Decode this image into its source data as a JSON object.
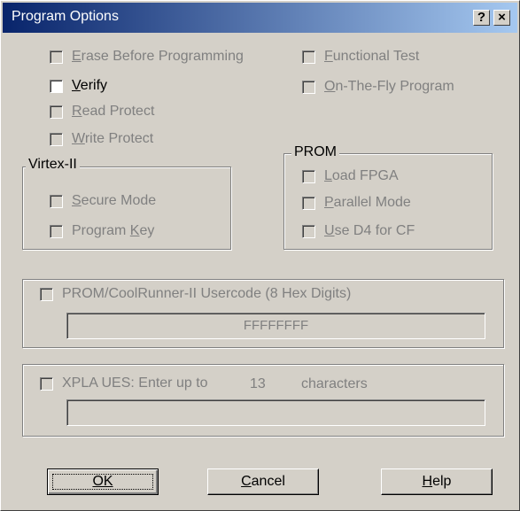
{
  "window": {
    "title": "Program Options",
    "help_glyph": "?",
    "close_glyph": "×"
  },
  "options": {
    "erase": {
      "pre": "",
      "mn": "E",
      "post": "rase Before Programming",
      "checked": false,
      "enabled": false
    },
    "verify": {
      "pre": "",
      "mn": "V",
      "post": "erify",
      "checked": false,
      "enabled": true
    },
    "read_protect": {
      "pre": "",
      "mn": "R",
      "post": "ead Protect",
      "checked": false,
      "enabled": false
    },
    "write_protect": {
      "pre": "",
      "mn": "W",
      "post": "rite Protect",
      "checked": false,
      "enabled": false
    },
    "functional_test": {
      "pre": "",
      "mn": "F",
      "post": "unctional Test",
      "checked": false,
      "enabled": false
    },
    "otf_program": {
      "pre": "",
      "mn": "O",
      "post": "n-The-Fly Program",
      "checked": false,
      "enabled": false
    }
  },
  "virtex": {
    "title": "Virtex-II",
    "secure_mode": {
      "pre": "",
      "mn": "S",
      "post": "ecure Mode",
      "checked": false,
      "enabled": false
    },
    "program_key": {
      "pre": "Program ",
      "mn": "K",
      "post": "ey",
      "checked": false,
      "enabled": false
    }
  },
  "prom": {
    "title": "PROM",
    "load_fpga": {
      "pre": "",
      "mn": "L",
      "post": "oad FPGA",
      "checked": false,
      "enabled": false
    },
    "parallel_mode": {
      "pre": "",
      "mn": "P",
      "post": "arallel Mode",
      "checked": false,
      "enabled": false
    },
    "use_d4": {
      "pre": "",
      "mn": "U",
      "post": "se D4 for CF",
      "checked": false,
      "enabled": false
    }
  },
  "usercode": {
    "label": "PROM/CoolRunner-II Usercode (8 Hex Digits)",
    "value": "FFFFFFFF",
    "enabled": false
  },
  "xpla": {
    "label": "XPLA UES: Enter up to",
    "count": "13",
    "suffix": "characters",
    "value": "",
    "enabled": false
  },
  "buttons": {
    "ok": "OK",
    "cancel_mn": "C",
    "cancel_rest": "ancel",
    "help_mn": "H",
    "help_rest": "elp"
  }
}
